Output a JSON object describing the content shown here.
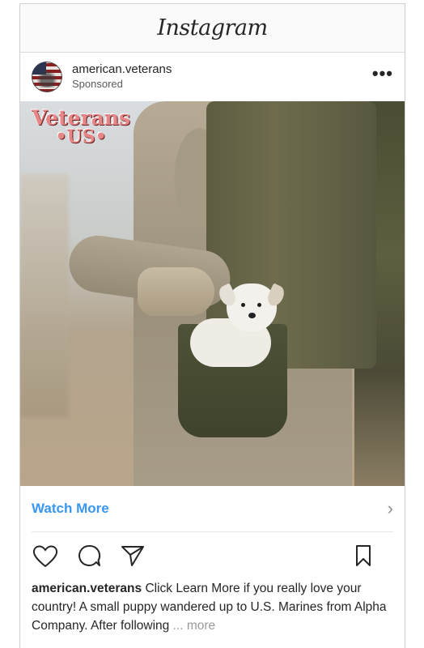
{
  "app": {
    "title": "Instagram"
  },
  "post": {
    "username": "american.veterans",
    "sponsored_label": "Sponsored",
    "more_icon": "more-options-icon",
    "image": {
      "brand_line1": "Veterans",
      "brand_line2": "•US•"
    },
    "cta": {
      "label": "Watch More",
      "chevron": "›"
    },
    "actions": [
      "heart-icon",
      "comment-icon",
      "share-icon",
      "bookmark-icon"
    ],
    "caption": {
      "username": "american.veterans",
      "text": "Click Learn More if you really love your country! A small puppy wandered up to U.S. Marines from Alpha Company. After following",
      "ellipsis": "...",
      "more_label": "more"
    }
  },
  "colors": {
    "link": "#3897f0",
    "brand_pink": "#e68687"
  }
}
